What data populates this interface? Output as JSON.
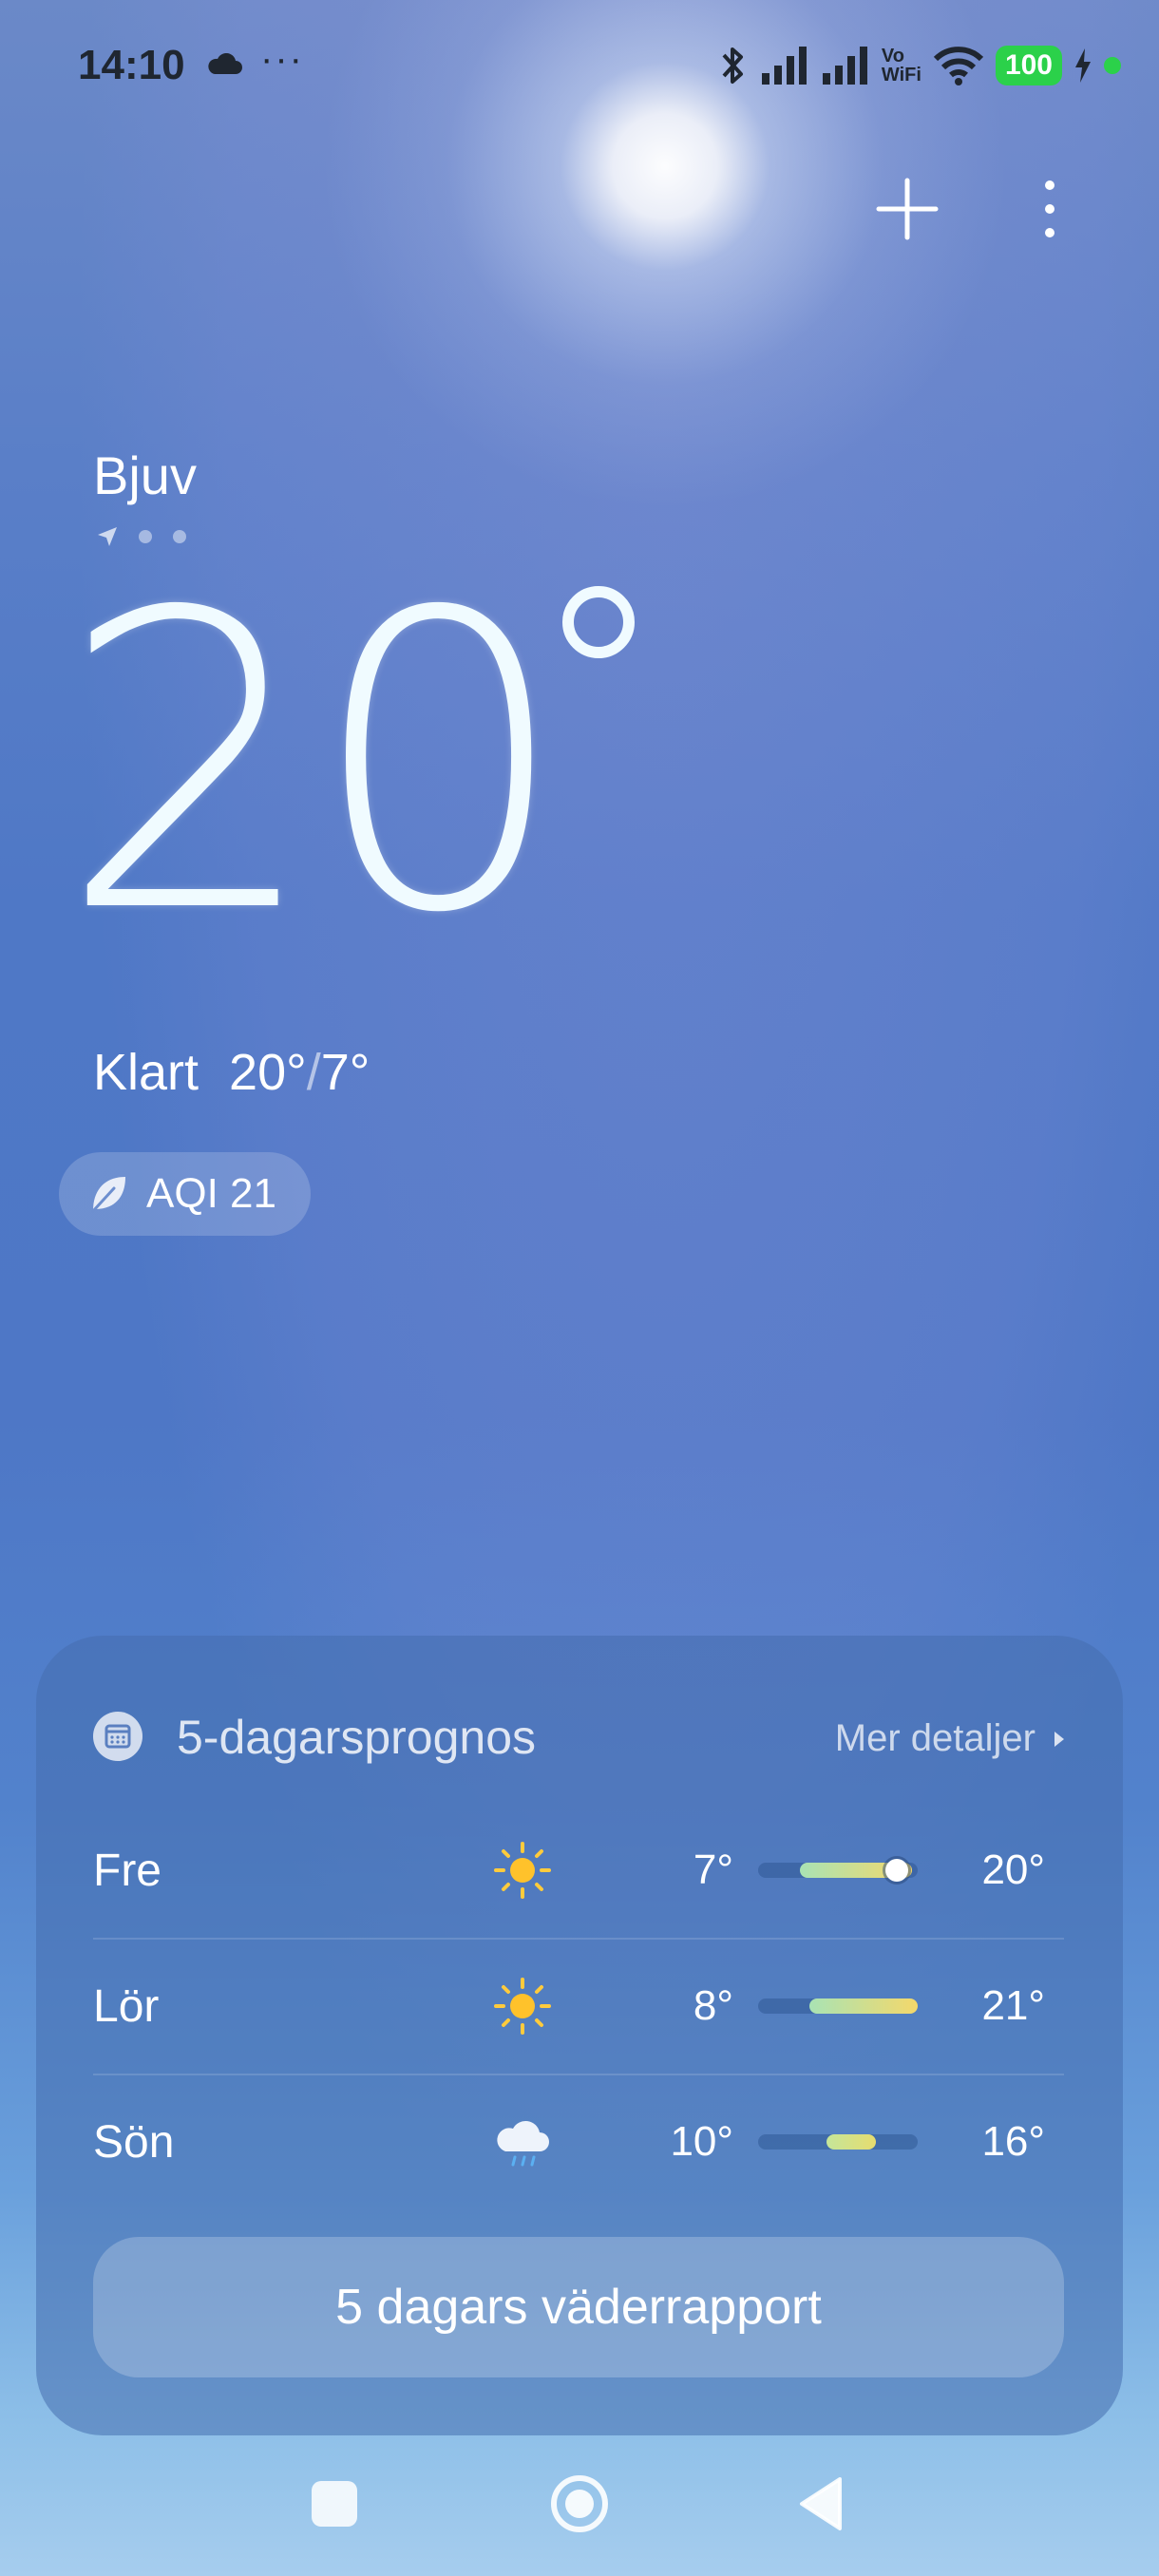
{
  "status_bar": {
    "time": "14:10",
    "overflow": "···",
    "vowifi": "Vo\nWiFi",
    "battery": "100",
    "icons": [
      "cloud-icon",
      "bluetooth-icon",
      "signal-icon",
      "signal-icon",
      "vowifi-icon",
      "wifi-icon",
      "battery-icon",
      "charging-icon",
      "dot-icon"
    ]
  },
  "location": {
    "city": "Bjuv"
  },
  "current": {
    "temperature": "20",
    "condition": "Klart",
    "high": "20°",
    "low": "7°",
    "separator": "/",
    "aqi_label": "AQI 21"
  },
  "forecast": {
    "title": "5-dagarsprognos",
    "more_label": "Mer detaljer",
    "days": [
      {
        "day": "Fre",
        "icon": "sun-icon",
        "low": "7°",
        "high": "20°"
      },
      {
        "day": "Lör",
        "icon": "sun-icon",
        "low": "8°",
        "high": "21°"
      },
      {
        "day": "Sön",
        "icon": "rain-cloud-icon",
        "low": "10°",
        "high": "16°"
      }
    ],
    "report_button": "5 dagars väderrapport"
  },
  "colors": {
    "accent_green": "#2bd14a",
    "bar_start": "#a9e3b4",
    "bar_end": "#f4d86b"
  }
}
